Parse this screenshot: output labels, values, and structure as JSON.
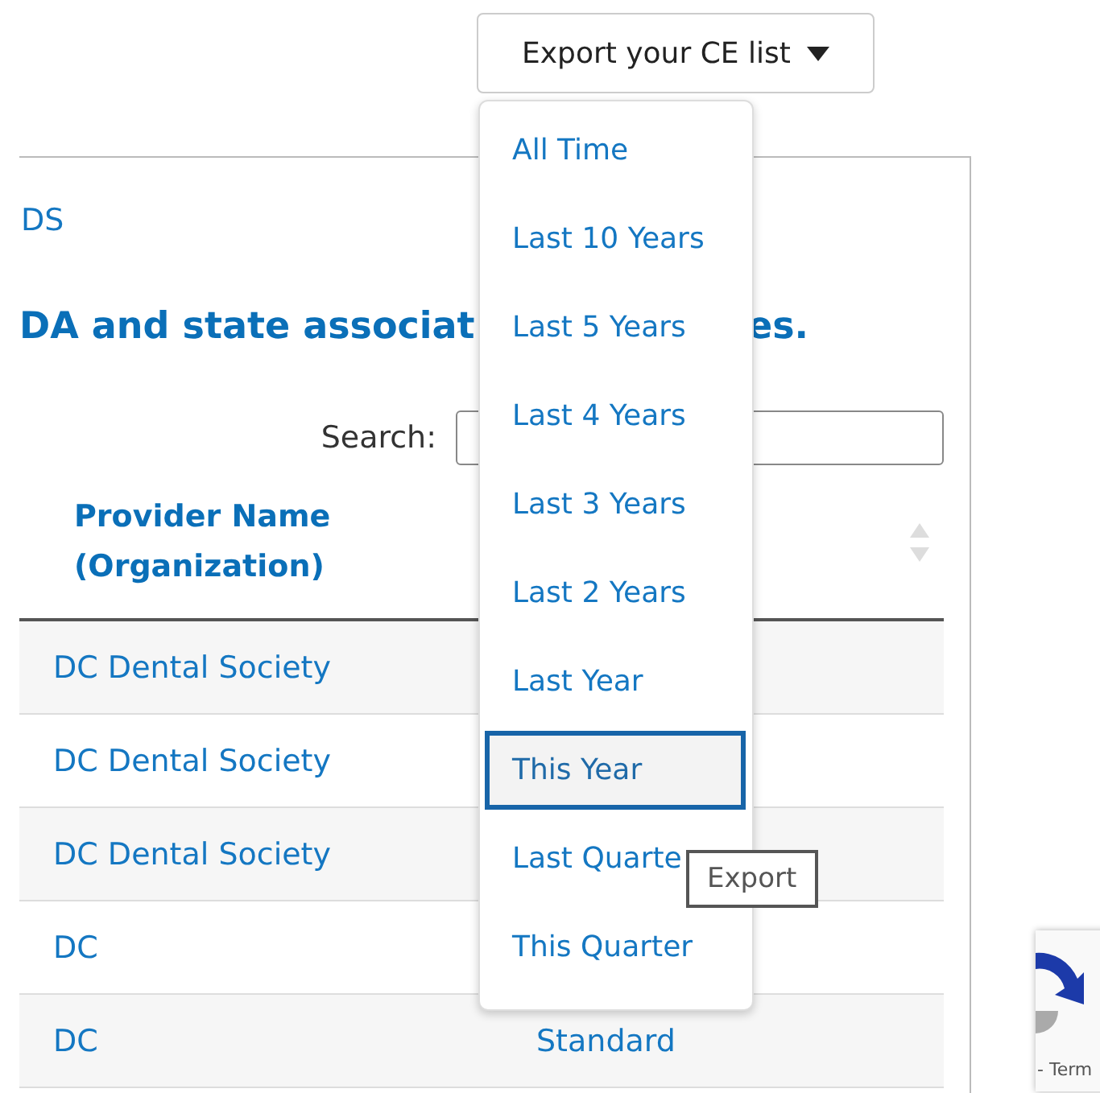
{
  "export_button": {
    "label": "Export your CE list"
  },
  "export_menu": {
    "items": [
      {
        "label": "All Time",
        "selected": false
      },
      {
        "label": "Last 10 Years",
        "selected": false
      },
      {
        "label": "Last 5 Years",
        "selected": false
      },
      {
        "label": "Last 4 Years",
        "selected": false
      },
      {
        "label": "Last 3 Years",
        "selected": false
      },
      {
        "label": "Last 2 Years",
        "selected": false
      },
      {
        "label": "Last Year",
        "selected": false
      },
      {
        "label": "This Year",
        "selected": true
      },
      {
        "label": "Last Quarte",
        "selected": false
      },
      {
        "label": "This Quarter",
        "selected": false
      }
    ]
  },
  "tooltip": "Export",
  "panel": {
    "subtitle": "DS",
    "heading_left": "DA and state associat",
    "heading_right": "es.",
    "search": {
      "label": "Search:"
    }
  },
  "table": {
    "columns": [
      "Provider Name (Organization)"
    ],
    "rows": [
      {
        "column_1": "DC Dental Society"
      },
      {
        "column_1": "DC Dental Society"
      },
      {
        "column_1": "DC Dental Society"
      },
      {
        "column_1": "DC"
      },
      {
        "column_1": "DC",
        "column_2": "Standard"
      }
    ]
  },
  "recaptcha": {
    "text": "- Term"
  }
}
